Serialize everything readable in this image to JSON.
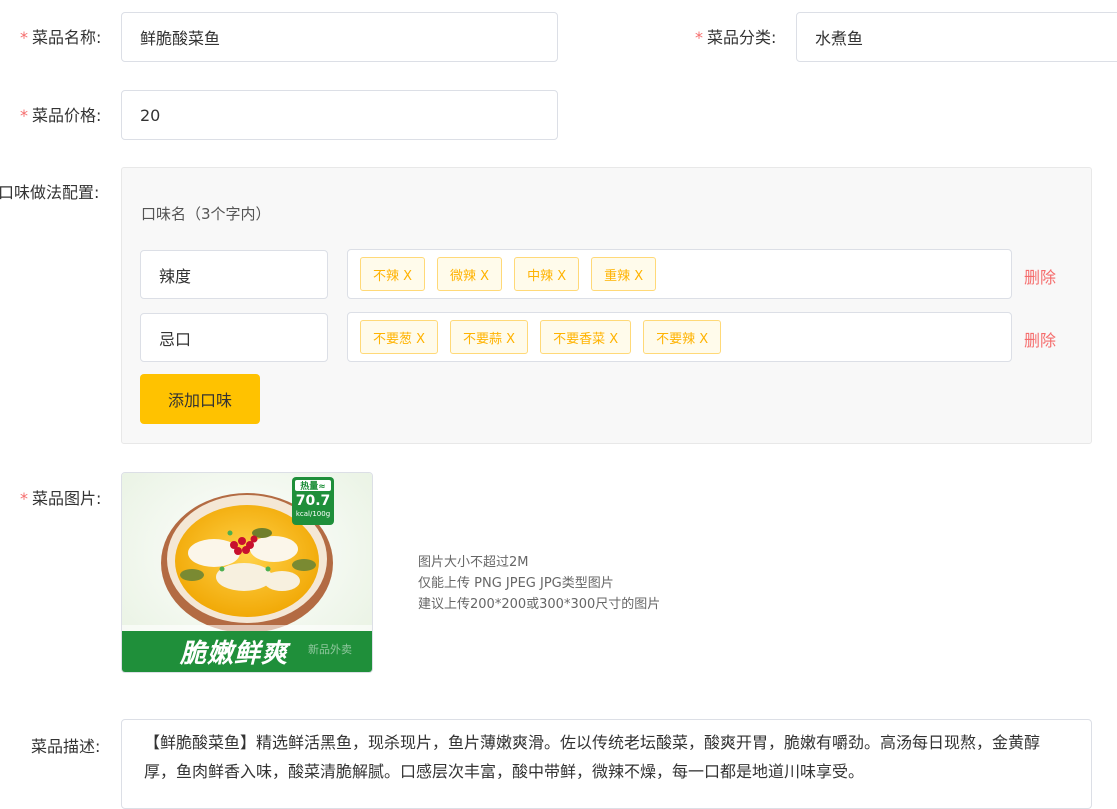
{
  "form": {
    "name_label": "菜品名称:",
    "name_value": "鲜脆酸菜鱼",
    "category_label": "菜品分类:",
    "category_value": "水煮鱼",
    "price_label": "菜品价格:",
    "price_value": "20",
    "flavor_label": "口味做法配置:",
    "flavor_hint": "口味名（3个字内）",
    "flavors": [
      {
        "name": "辣度",
        "tags": [
          "不辣 X",
          "微辣 X",
          "中辣 X",
          "重辣 X"
        ],
        "delete_label": "删除"
      },
      {
        "name": "忌口",
        "tags": [
          "不要葱 X",
          "不要蒜 X",
          "不要香菜 X",
          "不要辣 X"
        ],
        "delete_label": "删除"
      }
    ],
    "add_flavor_label": "添加口味",
    "image_label": "菜品图片:",
    "image_badge_top": "热量≈",
    "image_badge_value": "70.7",
    "image_badge_unit": "kcal/100g",
    "image_banner": "脆嫩鲜爽",
    "image_watermark": "新品外卖",
    "image_hints": [
      "图片大小不超过2M",
      "仅能上传 PNG JPEG JPG类型图片",
      "建议上传200*200或300*300尺寸的图片"
    ],
    "desc_label": "菜品描述:",
    "desc_value": "【鲜脆酸菜鱼】精选鲜活黑鱼，现杀现片，鱼片薄嫩爽滑。佐以传统老坛酸菜，酸爽开胃，脆嫩有嚼劲。高汤每日现熬，金黄醇厚，鱼肉鲜香入味，酸菜清脆解腻。口感层次丰富，酸中带鲜，微辣不燥，每一口都是地道川味享受。"
  },
  "colors": {
    "accent": "#ffc200",
    "required": "#f56c6c",
    "tag_text": "#ffb302",
    "tag_border": "#ffd978",
    "image_green": "#1f8f3a"
  },
  "icons": {
    "dish_image": "dish-photo"
  }
}
